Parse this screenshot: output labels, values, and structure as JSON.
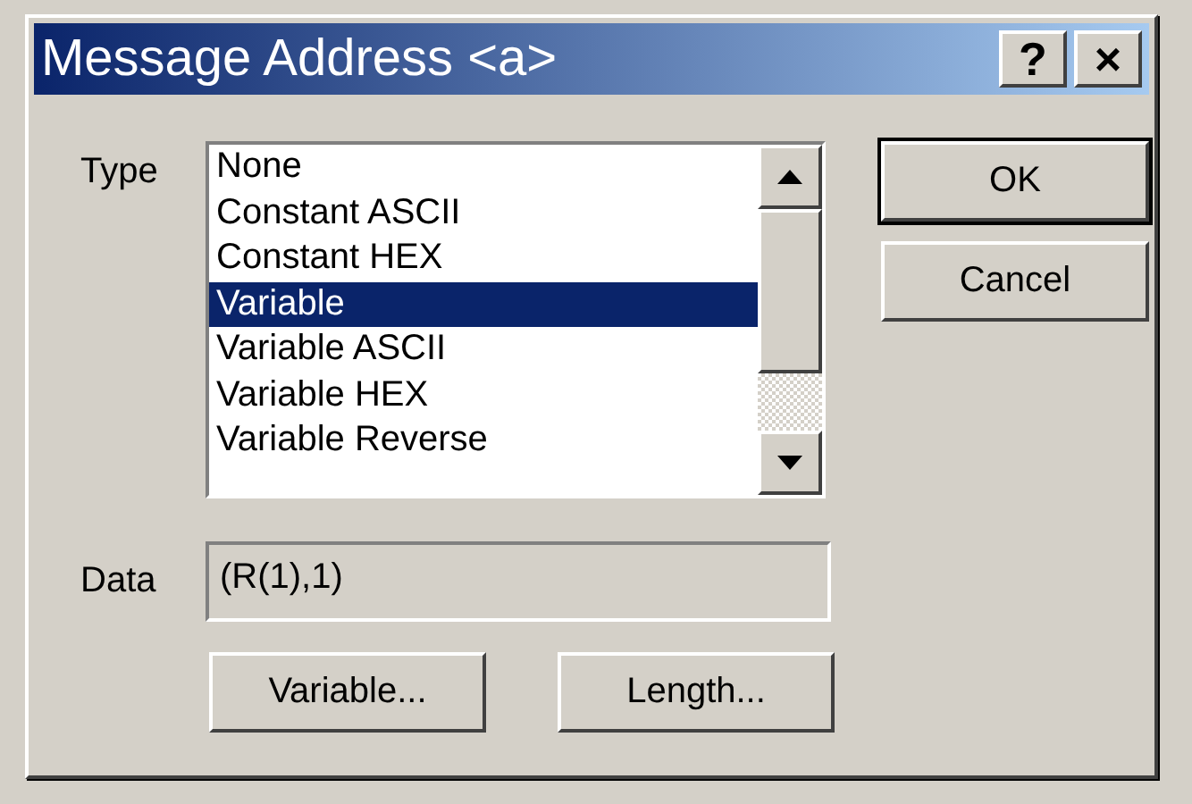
{
  "window": {
    "title": "Message Address <a>",
    "title_buttons": [
      "?",
      "×"
    ]
  },
  "type": {
    "label": "Type",
    "items": [
      {
        "label": "None",
        "selected": false
      },
      {
        "label": "Constant ASCII",
        "selected": false
      },
      {
        "label": "Constant HEX",
        "selected": false
      },
      {
        "label": "Variable",
        "selected": true
      },
      {
        "label": "Variable ASCII",
        "selected": false
      },
      {
        "label": "Variable HEX",
        "selected": false
      },
      {
        "label": "Variable Reverse",
        "selected": false
      }
    ]
  },
  "data": {
    "label": "Data",
    "value": "(R(1),1)",
    "disabled": true
  },
  "buttons": [
    {
      "label": "OK",
      "default": true
    },
    {
      "label": "Cancel",
      "default": false
    }
  ],
  "data_buttons": [
    "Variable...",
    "Length..."
  ]
}
